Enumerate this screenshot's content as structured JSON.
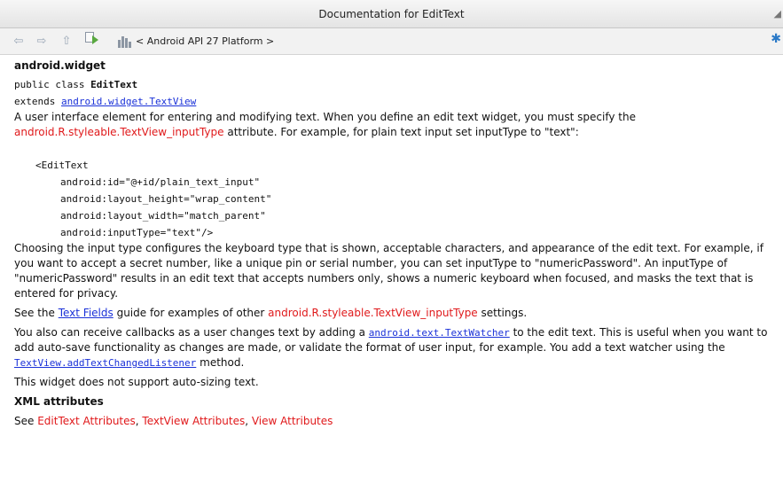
{
  "window": {
    "title": "Documentation for EditText"
  },
  "toolbar": {
    "icons": [
      "back-icon",
      "forward-icon",
      "up-icon",
      "edit-source-icon",
      "library-icon",
      "gear-icon"
    ],
    "breadcrumb": "< Android API 27 Platform >"
  },
  "doc": {
    "package": "android.widget",
    "decl_prefix": "public class ",
    "class_name": "EditText",
    "extends_prefix": "extends ",
    "extends_link": "android.widget.TextView",
    "intro_1": "A user interface element for entering and modifying text. When you define an edit text widget, you must specify the",
    "intro_link": "android.R.styleable.TextView_inputType",
    "intro_2": " attribute. For example, for plain text input set inputType to \"text\":",
    "code": {
      "open": "<EditText",
      "lines": [
        "android:id=\"@+id/plain_text_input\"",
        "android:layout_height=\"wrap_content\"",
        "android:layout_width=\"match_parent\"",
        "android:inputType=\"text\"/>"
      ]
    },
    "p2": "Choosing the input type configures the keyboard type that is shown, acceptable characters, and appearance of the edit text. For example, if you want to accept a secret number, like a unique pin or serial number, you can set inputType to \"numericPassword\". An inputType of \"numericPassword\" results in an edit text that accepts numbers only, shows a numeric keyboard when focused, and masks the text that is entered for privacy.",
    "p3_prefix": "See the ",
    "p3_link": "Text Fields",
    "p3_mid": " guide for examples of other ",
    "p3_red": "android.R.styleable.TextView_inputType",
    "p3_suffix": " settings.",
    "p4_prefix": "You also can receive callbacks as a user changes text by adding a ",
    "p4_link": "android.text.TextWatcher",
    "p4_mid": " to the edit text. This is useful when you want to add auto-save functionality as changes are made, or validate the format of user input, for example. You add a text watcher using the ",
    "p4_link2": "TextView.addTextChangedListener",
    "p4_suffix": " method.",
    "p5": "This widget does not support auto-sizing text.",
    "xml_heading": "XML attributes",
    "see_prefix": "See ",
    "see_links": [
      "EditText Attributes",
      "TextView Attributes",
      "View Attributes"
    ],
    "see_sep": ", "
  },
  "colors": {
    "link": "#1a31d8",
    "reference": "#e0191b",
    "accent": "#2a79c7"
  }
}
